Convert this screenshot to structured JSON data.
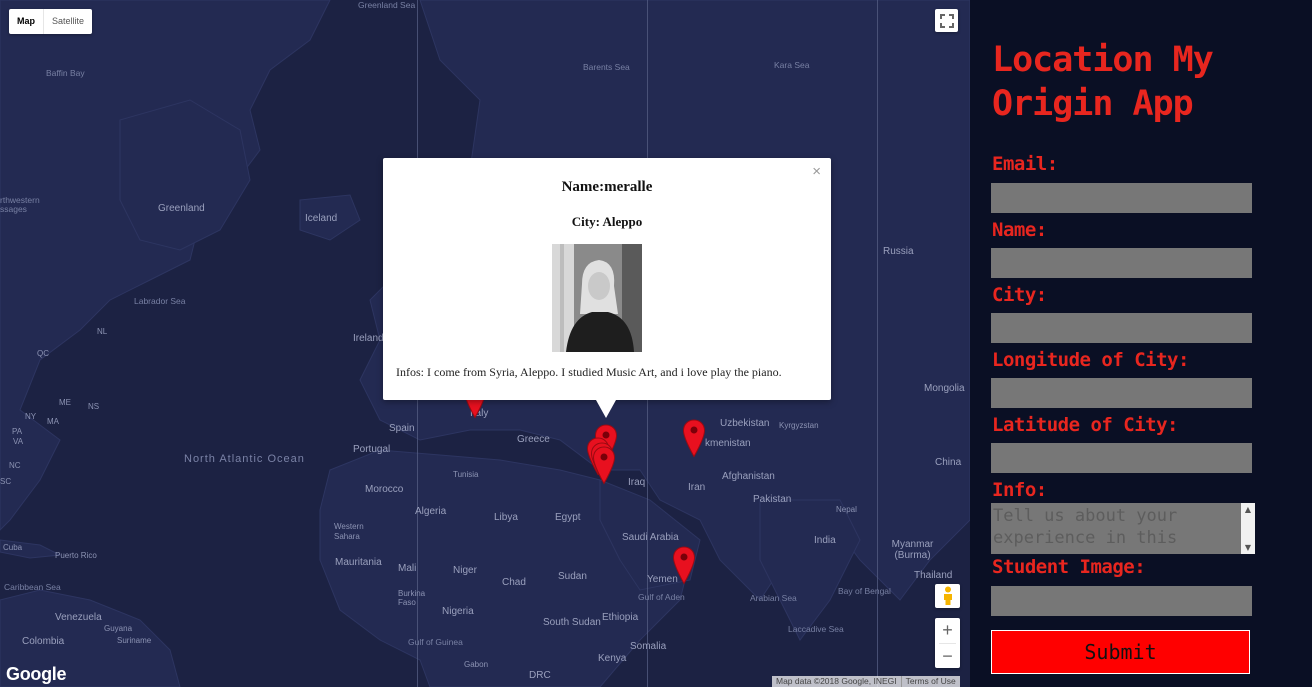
{
  "map": {
    "type_control": {
      "map_label": "Map",
      "satellite_label": "Satellite"
    },
    "labels": {
      "greenland_sea": "Greenland Sea",
      "baffin_bay": "Baffin Bay",
      "barents_sea": "Barents Sea",
      "kara_sea": "Kara Sea",
      "northwestern_passages_1": "rthwestern",
      "northwestern_passages_2": "ssages",
      "greenland": "Greenland",
      "iceland": "Iceland",
      "russia": "Russia",
      "labrador_sea": "Labrador Sea",
      "nl": "NL",
      "qc": "QC",
      "ireland": "Ireland",
      "mongolia": "Mongolia",
      "ny": "NY",
      "me": "ME",
      "ns": "NS",
      "pa": "PA",
      "ma": "MA",
      "va": "VA",
      "nc": "NC",
      "sc": "SC",
      "italy": "Italy",
      "spain": "Spain",
      "greece": "Greece",
      "uzbekistan": "Uzbekistan",
      "kyrgyzstan": "Kyrgyzstan",
      "turkmenistan": "kmenistan",
      "north_atlantic_ocean": "North Atlantic Ocean",
      "portugal": "Portugal",
      "tunisia": "Tunisia",
      "iraq": "Iraq",
      "afghanistan": "Afghanistan",
      "china": "China",
      "iran": "Iran",
      "morocco": "Morocco",
      "pakistan": "Pakistan",
      "algeria": "Algeria",
      "libya": "Libya",
      "egypt": "Egypt",
      "nepal": "Nepal",
      "western_sahara": "Western Sahara",
      "saudi_arabia": "Saudi Arabia",
      "india": "India",
      "cuba": "Cuba",
      "puerto_rico": "Puerto Rico",
      "myanmar": "Myanmar (Burma)",
      "mauritania": "Mauritania",
      "mali": "Mali",
      "niger": "Niger",
      "chad": "Chad",
      "sudan": "Sudan",
      "yemen": "Yemen",
      "caribbean_sea": "Caribbean Sea",
      "burkina_faso": "Burkina Faso",
      "gulf_of_aden": "Gulf of Aden",
      "arabian_sea": "Arabian Sea",
      "bay_of_bengal": "Bay of Bengal",
      "thailand": "Thailand",
      "venezuela": "Venezuela",
      "nigeria": "Nigeria",
      "ethiopia": "Ethiopia",
      "south_sudan": "South Sudan",
      "guyana": "Guyana",
      "suriname": "Suriname",
      "somalia": "Somalia",
      "laccadive_sea": "Laccadive Sea",
      "colombia": "Colombia",
      "gulf_of_guinea": "Gulf of Guinea",
      "kenya": "Kenya",
      "gabon": "Gabon",
      "drc": "DRC"
    },
    "zoom_in": "+",
    "zoom_out": "−",
    "logo": "Google",
    "attribution": "Map data ©2018 Google, INEGI",
    "terms": "Terms of Use",
    "marker_color": "#e8101f"
  },
  "infowindow": {
    "name": "Name:meralle",
    "city": "City: Aleppo",
    "infos": "Infos: I come from Syria, Aleppo. I studied Music Art, and i love play the piano.",
    "close": "×"
  },
  "form": {
    "title": "Location My Origin App",
    "email_label": "Email:",
    "name_label": "Name:",
    "city_label": "City:",
    "longitude_label": "Longitude of City:",
    "latitude_label": "Latitude of City:",
    "info_label": "Info:",
    "info_placeholder": "Tell us about your experience in this",
    "image_label": "Student Image:",
    "submit_label": "Submit",
    "accent_color": "#e8261f"
  }
}
